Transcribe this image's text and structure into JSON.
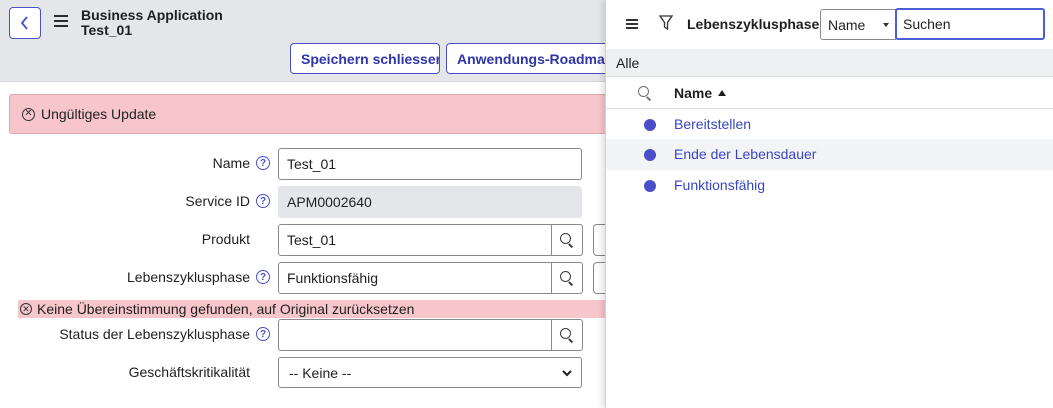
{
  "header": {
    "app_title": "Business Application",
    "record_name": "Test_01",
    "buttons": {
      "save_close": "Speichern schliessen",
      "roadmap": "Anwendungs-Roadmap"
    }
  },
  "error_banner": {
    "message": "Ungültiges Update"
  },
  "form": {
    "name": {
      "label": "Name",
      "value": "Test_01"
    },
    "service_id": {
      "label": "Service ID",
      "value": "APM0002640"
    },
    "produkt": {
      "label": "Produkt",
      "value": "Test_01"
    },
    "lebenszyklusphase": {
      "label": "Lebenszyklusphase",
      "value": "Funktionsfähig"
    },
    "warning": "Keine Übereinstimmung gefunden, auf Original zurücksetzen",
    "status_lebenszyklusphase": {
      "label": "Status der Lebenszyklusphase",
      "value": ""
    },
    "geschaeftskritikalitaet": {
      "label": "Geschäftskritikalität",
      "value": "-- Keine --"
    }
  },
  "lookup_panel": {
    "title": "Lebenszyklusphasen",
    "search_field_select": "Name",
    "search_value": "Suchen",
    "breadcrumb": "Alle",
    "column_header": "Name",
    "rows": [
      {
        "label": "Bereitstellen"
      },
      {
        "label": "Ende der Lebensdauer"
      },
      {
        "label": "Funktionsfähig"
      }
    ]
  },
  "colors": {
    "accent": "#4a4fc9",
    "error_bg": "#f7c6cb",
    "header_bg": "#e4e6ea",
    "link": "#3a45c4"
  }
}
